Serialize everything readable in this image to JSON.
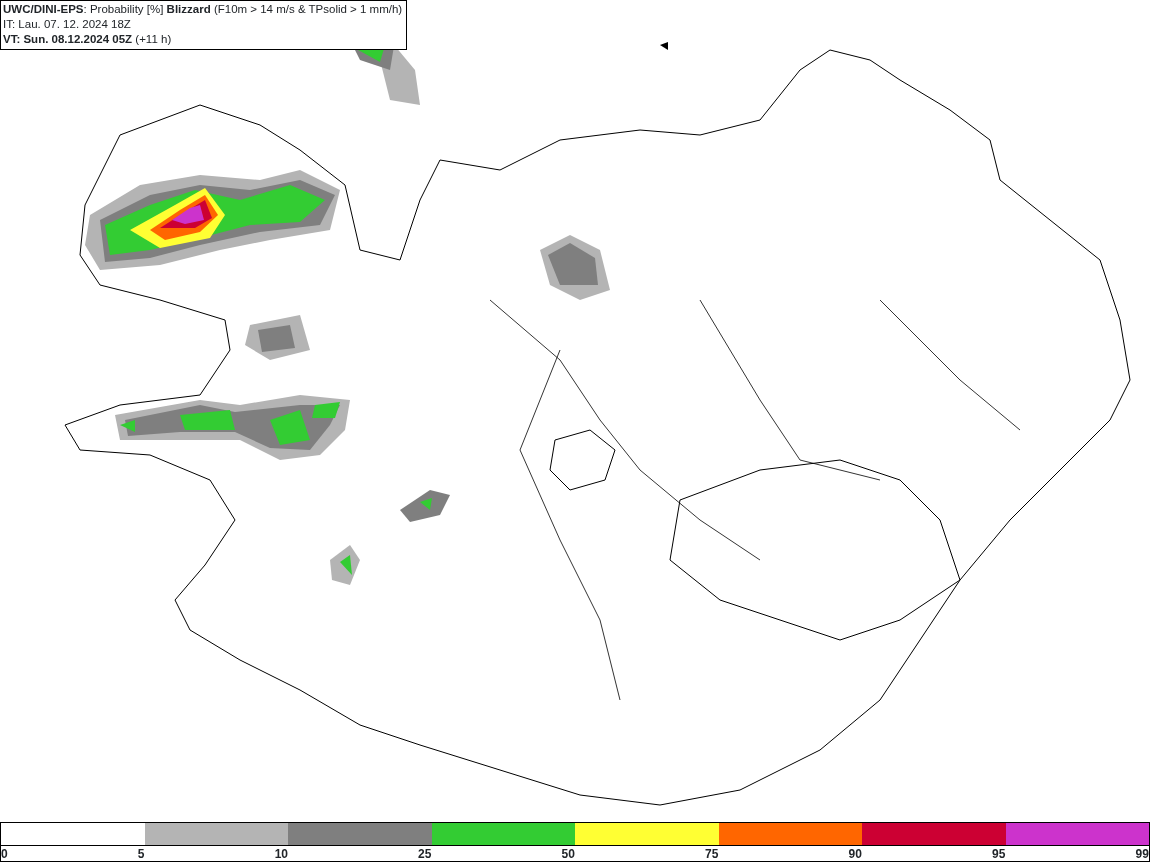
{
  "header": {
    "title": "**UWC/DINI-EPS**: Probability [%] **Blizzard** (F10m > 14 m/s & TPsolid > 1 mm/h)",
    "init_time": "IT: Lau. 07. 12. 2024 18Z",
    "valid_time": "**VT: Sun. 08.12.2024 05Z** (+11 h)"
  },
  "legend": {
    "segments": [
      {
        "color": "#ffffff"
      },
      {
        "color": "#b4b4b4"
      },
      {
        "color": "#7f7f7f"
      },
      {
        "color": "#33cc33"
      },
      {
        "color": "#ffff33"
      },
      {
        "color": "#ff6600"
      },
      {
        "color": "#cc0033"
      },
      {
        "color": "#cc33cc"
      }
    ],
    "ticks": [
      "0",
      "5",
      "10",
      "25",
      "50",
      "75",
      "90",
      "95",
      "99"
    ]
  }
}
